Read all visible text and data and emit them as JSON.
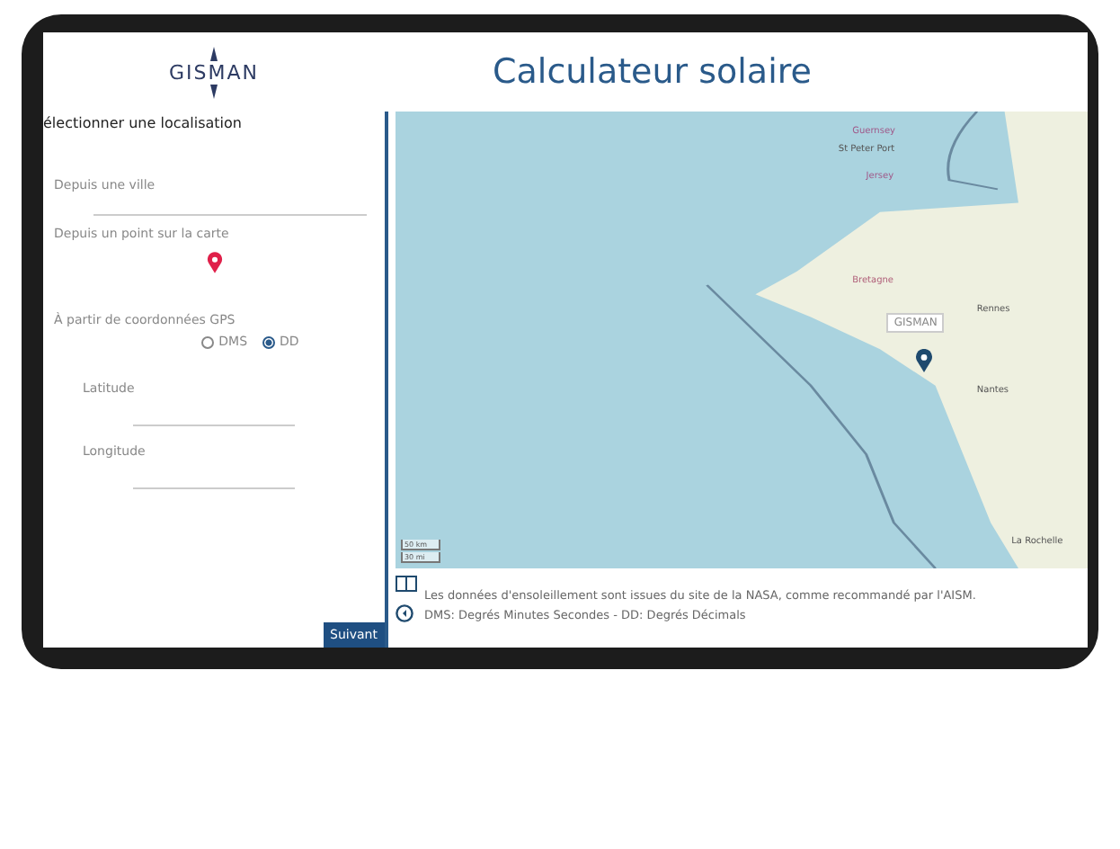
{
  "header": {
    "logo": "GISMAN",
    "title": "Calculateur solaire"
  },
  "sidebar": {
    "heading": "électionner une localisation",
    "city": {
      "label": "Depuis une ville"
    },
    "map_point": {
      "label": "Depuis un point sur la carte"
    },
    "gps": {
      "label": "À partir de coordonnées GPS",
      "formats": [
        {
          "label": "DMS",
          "selected": false
        },
        {
          "label": "DD",
          "selected": true
        }
      ],
      "fields": [
        {
          "label": "Latitude"
        },
        {
          "label": "Longitude"
        }
      ]
    },
    "next_button": "Suivant"
  },
  "map": {
    "labels": [
      {
        "text": "Guernsey",
        "kind": "island"
      },
      {
        "text": "St Peter Port",
        "kind": "city"
      },
      {
        "text": "Jersey",
        "kind": "island"
      },
      {
        "text": "Bretagne",
        "kind": "region"
      },
      {
        "text": "Rennes",
        "kind": "city"
      },
      {
        "text": "Nantes",
        "kind": "city"
      },
      {
        "text": "La Rochelle",
        "kind": "city"
      }
    ],
    "marker_label": "GISMAN",
    "scale": [
      "50 km",
      "30 mi"
    ]
  },
  "notes": [
    "Les données d'ensoleillement sont issues du site de la NASA, comme recommandé par l'AISM.",
    "DMS: Degrés Minutes Secondes - DD: Degrés Décimals"
  ]
}
